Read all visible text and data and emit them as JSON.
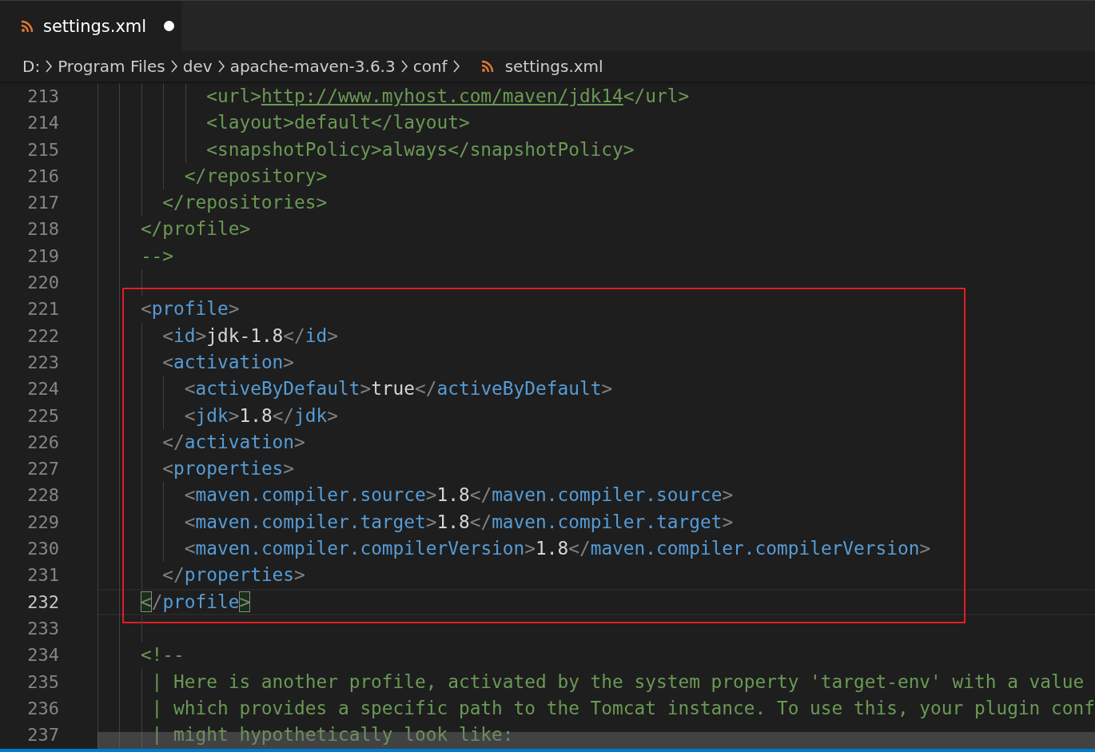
{
  "tab": {
    "label": "settings.xml",
    "selected": true,
    "dirty": true
  },
  "breadcrumb": [
    {
      "label": "D:",
      "kind": "folder"
    },
    {
      "label": "Program Files",
      "kind": "folder"
    },
    {
      "label": "dev",
      "kind": "folder"
    },
    {
      "label": "apache-maven-3.6.3",
      "kind": "folder"
    },
    {
      "label": "conf",
      "kind": "folder"
    },
    {
      "label": "settings.xml",
      "kind": "file"
    }
  ],
  "editor": {
    "groups": [
      {
        "kind": "plain",
        "lines": [
          {
            "number": "213",
            "current": false,
            "tokens": [
              {
                "kind": "comment",
                "text": "          <url>"
              },
              {
                "kind": "link",
                "text": "http://www.myhost.com/maven/jdk14"
              },
              {
                "kind": "comment",
                "text": "</url>"
              }
            ]
          },
          {
            "number": "214",
            "current": false,
            "tokens": [
              {
                "kind": "comment",
                "text": "          <layout>default</layout>"
              }
            ]
          },
          {
            "number": "215",
            "current": false,
            "tokens": [
              {
                "kind": "comment",
                "text": "          <snapshotPolicy>always</snapshotPolicy>"
              }
            ]
          },
          {
            "number": "216",
            "current": false,
            "tokens": [
              {
                "kind": "comment",
                "text": "        </repository>"
              }
            ]
          },
          {
            "number": "217",
            "current": false,
            "tokens": [
              {
                "kind": "comment",
                "text": "      </repositories>"
              }
            ]
          },
          {
            "number": "218",
            "current": false,
            "tokens": [
              {
                "kind": "comment",
                "text": "    </profile>"
              }
            ]
          },
          {
            "number": "219",
            "current": false,
            "tokens": [
              {
                "kind": "comment",
                "text": "    -->"
              }
            ]
          },
          {
            "number": "220",
            "current": false
          }
        ]
      },
      {
        "kind": "boxed",
        "lines": [
          {
            "number": "221",
            "current": false,
            "tokens": [
              {
                "kind": "punct",
                "text": "    <"
              },
              {
                "kind": "tag",
                "text": "profile"
              },
              {
                "kind": "punct",
                "text": ">"
              }
            ]
          },
          {
            "number": "222",
            "current": false,
            "tokens": [
              {
                "kind": "punct",
                "text": "      <"
              },
              {
                "kind": "tag",
                "text": "id"
              },
              {
                "kind": "punct",
                "text": ">"
              },
              {
                "kind": "text",
                "text": "jdk-1.8"
              },
              {
                "kind": "punct",
                "text": "</"
              },
              {
                "kind": "tag",
                "text": "id"
              },
              {
                "kind": "punct",
                "text": ">"
              }
            ]
          },
          {
            "number": "223",
            "current": false,
            "tokens": [
              {
                "kind": "punct",
                "text": "      <"
              },
              {
                "kind": "tag",
                "text": "activation"
              },
              {
                "kind": "punct",
                "text": ">"
              }
            ]
          },
          {
            "number": "224",
            "current": false,
            "tokens": [
              {
                "kind": "punct",
                "text": "        <"
              },
              {
                "kind": "tag",
                "text": "activeByDefault"
              },
              {
                "kind": "punct",
                "text": ">"
              },
              {
                "kind": "text",
                "text": "true"
              },
              {
                "kind": "punct",
                "text": "</"
              },
              {
                "kind": "tag",
                "text": "activeByDefault"
              },
              {
                "kind": "punct",
                "text": ">"
              }
            ]
          },
          {
            "number": "225",
            "current": false,
            "tokens": [
              {
                "kind": "punct",
                "text": "        <"
              },
              {
                "kind": "tag",
                "text": "jdk"
              },
              {
                "kind": "punct",
                "text": ">"
              },
              {
                "kind": "text",
                "text": "1.8"
              },
              {
                "kind": "punct",
                "text": "</"
              },
              {
                "kind": "tag",
                "text": "jdk"
              },
              {
                "kind": "punct",
                "text": ">"
              }
            ]
          },
          {
            "number": "226",
            "current": false,
            "tokens": [
              {
                "kind": "punct",
                "text": "      </"
              },
              {
                "kind": "tag",
                "text": "activation"
              },
              {
                "kind": "punct",
                "text": ">"
              }
            ]
          },
          {
            "number": "227",
            "current": false,
            "tokens": [
              {
                "kind": "punct",
                "text": "      <"
              },
              {
                "kind": "tag",
                "text": "properties"
              },
              {
                "kind": "punct",
                "text": ">"
              }
            ]
          },
          {
            "number": "228",
            "current": false,
            "tokens": [
              {
                "kind": "punct",
                "text": "        <"
              },
              {
                "kind": "tag",
                "text": "maven.compiler.source"
              },
              {
                "kind": "punct",
                "text": ">"
              },
              {
                "kind": "text",
                "text": "1.8"
              },
              {
                "kind": "punct",
                "text": "</"
              },
              {
                "kind": "tag",
                "text": "maven.compiler.source"
              },
              {
                "kind": "punct",
                "text": ">"
              }
            ]
          },
          {
            "number": "229",
            "current": false,
            "tokens": [
              {
                "kind": "punct",
                "text": "        <"
              },
              {
                "kind": "tag",
                "text": "maven.compiler.target"
              },
              {
                "kind": "punct",
                "text": ">"
              },
              {
                "kind": "text",
                "text": "1.8"
              },
              {
                "kind": "punct",
                "text": "</"
              },
              {
                "kind": "tag",
                "text": "maven.compiler.target"
              },
              {
                "kind": "punct",
                "text": ">"
              }
            ]
          },
          {
            "number": "230",
            "current": false,
            "tokens": [
              {
                "kind": "punct",
                "text": "        <"
              },
              {
                "kind": "tag",
                "text": "maven.compiler.compilerVersion"
              },
              {
                "kind": "punct",
                "text": ">"
              },
              {
                "kind": "text",
                "text": "1.8"
              },
              {
                "kind": "punct",
                "text": "</"
              },
              {
                "kind": "tag",
                "text": "maven.compiler.compilerVersion"
              },
              {
                "kind": "punct",
                "text": ">"
              }
            ]
          },
          {
            "number": "231",
            "current": false,
            "tokens": [
              {
                "kind": "punct",
                "text": "      </"
              },
              {
                "kind": "tag",
                "text": "properties"
              },
              {
                "kind": "punct",
                "text": ">"
              }
            ]
          },
          {
            "number": "232",
            "current": true,
            "tokens": [
              {
                "kind": "punct",
                "text": "    <",
                "matched": true
              },
              {
                "kind": "punct",
                "text": "/"
              },
              {
                "kind": "tag",
                "text": "profile"
              },
              {
                "kind": "punct",
                "text": ">",
                "matched": true
              }
            ]
          }
        ]
      },
      {
        "kind": "plain",
        "lines": [
          {
            "number": "233",
            "current": false
          },
          {
            "number": "234",
            "current": false,
            "tokens": [
              {
                "kind": "comment",
                "text": "    <!--"
              }
            ]
          },
          {
            "number": "235",
            "current": false,
            "tokens": [
              {
                "kind": "comment",
                "text": "     | Here is another profile, activated by the system property 'target-env' with a value"
              }
            ]
          },
          {
            "number": "236",
            "current": false,
            "tokens": [
              {
                "kind": "comment",
                "text": "     | which provides a specific path to the Tomcat instance. To use this, your plugin conf"
              }
            ]
          },
          {
            "number": "237",
            "current": false,
            "tokens": [
              {
                "kind": "comment",
                "text": "     | might hypothetically look like:"
              }
            ]
          }
        ]
      }
    ]
  }
}
